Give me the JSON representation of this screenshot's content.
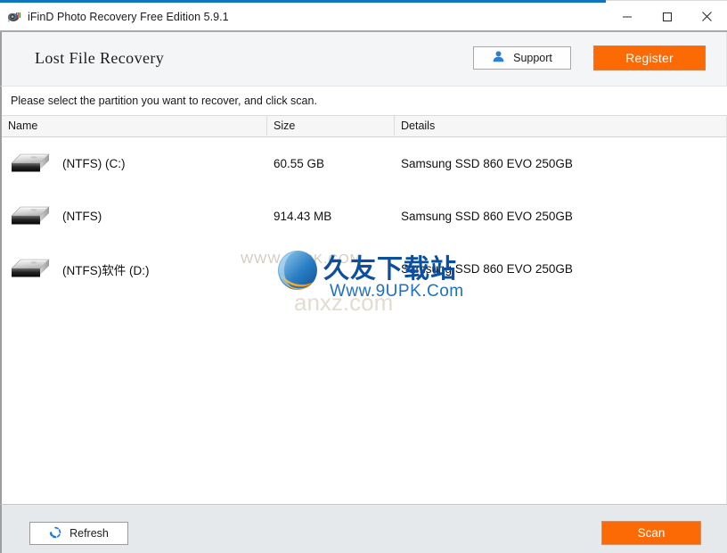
{
  "window": {
    "title": "iFinD Photo Recovery Free Edition 5.9.1",
    "app_icon": "camera-icon",
    "accent_color": "#1075c1",
    "controls": {
      "minimize": "minimize-icon",
      "maximize": "maximize-icon",
      "close": "close-icon"
    }
  },
  "header": {
    "page_title": "Lost File Recovery",
    "support_label": "Support",
    "support_icon": "user-icon",
    "register_label": "Register",
    "register_color": "#fc6a06"
  },
  "instruction": {
    "text": "Please select the partition you want to recover, and click scan."
  },
  "table": {
    "columns": [
      "Name",
      "Size",
      "Details"
    ],
    "rows": [
      {
        "icon": "hard-drive-icon",
        "name": "(NTFS) (C:)",
        "size": "60.55 GB",
        "details": "Samsung SSD 860 EVO 250GB"
      },
      {
        "icon": "hard-drive-icon",
        "name": "(NTFS)",
        "size": "914.43 MB",
        "details": "Samsung SSD 860 EVO 250GB"
      },
      {
        "icon": "hard-drive-icon",
        "name": "(NTFS)软件 (D:)",
        "size": "",
        "details": "Samsung SSD 860 EVO 250GB"
      }
    ]
  },
  "footer": {
    "refresh_label": "Refresh",
    "refresh_icon": "refresh-circle-icon",
    "scan_label": "Scan",
    "scan_color": "#fc6a06"
  },
  "watermark": {
    "faint_top": "WWW.9UPK.COM",
    "chinese": "久友下载站",
    "url": "Www.9UPK.Com",
    "faint_bottom": "anxz.com",
    "logo": "globe-logo-icon"
  }
}
